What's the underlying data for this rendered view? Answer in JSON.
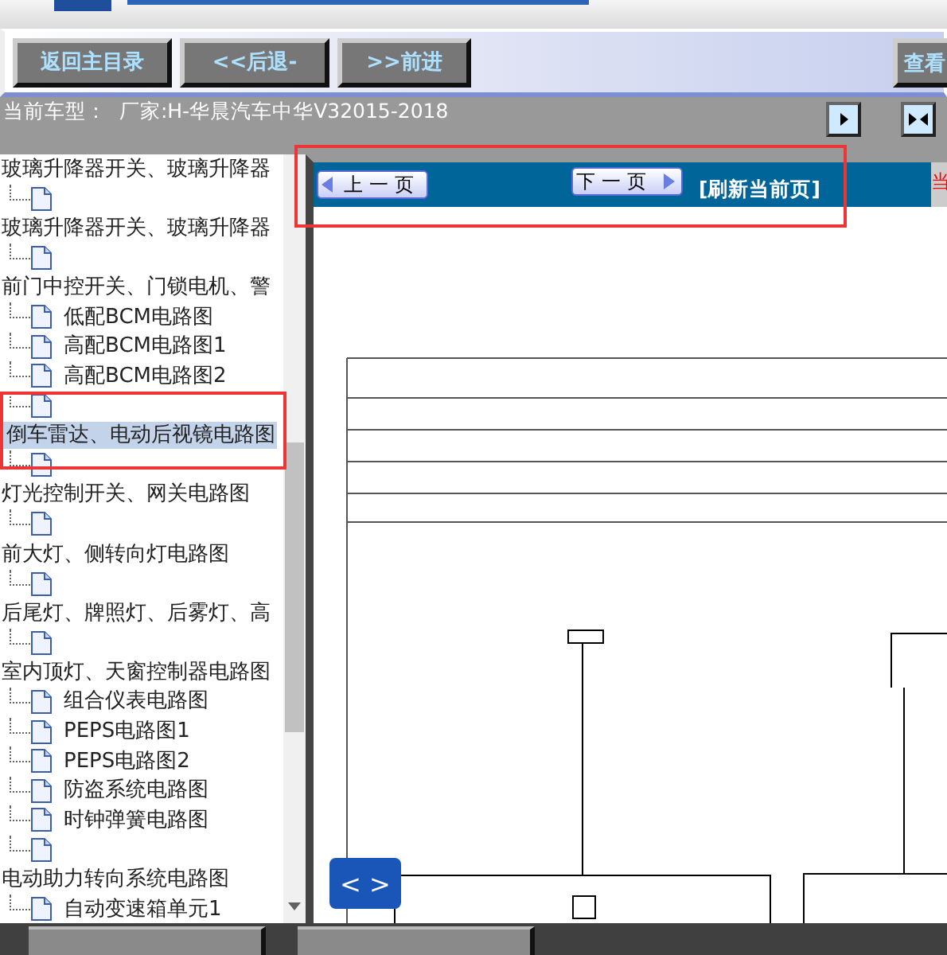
{
  "toolbar": {
    "buttons": [
      "返回主目录",
      "<<后退-",
      ">>前进"
    ],
    "view_button": "查看"
  },
  "model_bar": {
    "text": "当前车型：  厂家:H-华晨汽车中华V32015-2018"
  },
  "tree": {
    "items": [
      {
        "label": "玻璃升降器开关、玻璃升降器",
        "selected": false
      },
      {
        "label": "玻璃升降器开关、玻璃升降器",
        "selected": false
      },
      {
        "label": "前门中控开关、门锁电机、警",
        "selected": false,
        "children": [
          {
            "label": "低配BCM电路图",
            "selected": false
          },
          {
            "label": "高配BCM电路图1",
            "selected": false
          },
          {
            "label": "高配BCM电路图2",
            "selected": false
          }
        ]
      },
      {
        "label": "倒车雷达、电动后视镜电路图",
        "selected": true
      },
      {
        "label": "灯光控制开关、网关电路图",
        "selected": false
      },
      {
        "label": "前大灯、侧转向灯电路图",
        "selected": false
      },
      {
        "label": "后尾灯、牌照灯、后雾灯、高",
        "selected": false
      },
      {
        "label": "室内顶灯、天窗控制器电路图",
        "selected": false,
        "children": [
          {
            "label": "组合仪表电路图",
            "selected": false
          },
          {
            "label": "PEPS电路图1",
            "selected": false
          },
          {
            "label": "PEPS电路图2",
            "selected": false
          },
          {
            "label": "防盗系统电路图",
            "selected": false
          },
          {
            "label": "时钟弹簧电路图",
            "selected": false
          }
        ]
      },
      {
        "label": "电动助力转向系统电路图",
        "selected": false,
        "children": [
          {
            "label": "自动变速箱单元1",
            "selected": false
          }
        ]
      }
    ]
  },
  "viewer": {
    "prev_button": "上一页",
    "next_button": "下一页",
    "refresh_link": "[刷新当前页]",
    "side_text": "当",
    "nav_button": "< >"
  }
}
